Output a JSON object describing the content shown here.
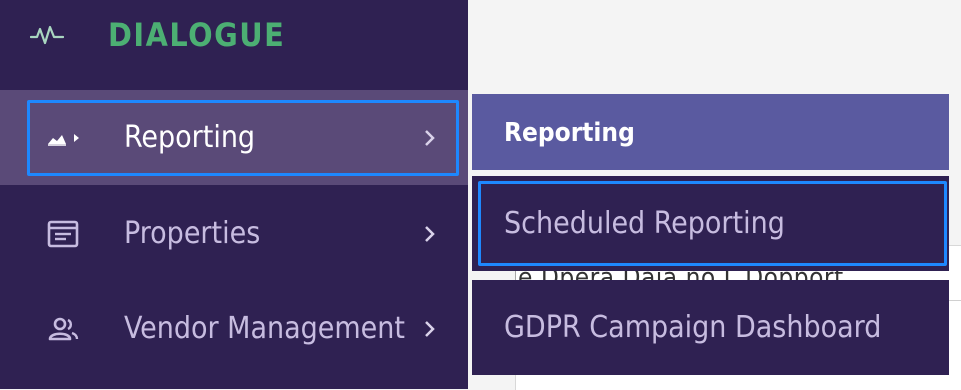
{
  "background": {
    "partial_text": "le  Dpera  Daia  no  L  Dopport"
  },
  "sidebar": {
    "brand": {
      "label": "DIALOGUE",
      "icon": "activity-pulse-icon",
      "color": "#4caf73"
    },
    "items": [
      {
        "label": "Reporting",
        "icon": "area-chart-icon",
        "active": true
      },
      {
        "label": "Properties",
        "icon": "browser-window-icon",
        "active": false
      },
      {
        "label": "Vendor Management",
        "icon": "people-icon",
        "active": false
      }
    ]
  },
  "submenu": {
    "title": "Reporting",
    "items": [
      {
        "label": "Scheduled Reporting",
        "focused": true
      },
      {
        "label": "GDPR Campaign Dashboard",
        "focused": false
      }
    ]
  },
  "colors": {
    "sidebar_bg": "#2f2152",
    "active_item_bg": "#5a4a78",
    "submenu_header_bg": "#5a5aa0",
    "focus_ring": "#1e88ff",
    "text_muted": "#c7bce0"
  }
}
